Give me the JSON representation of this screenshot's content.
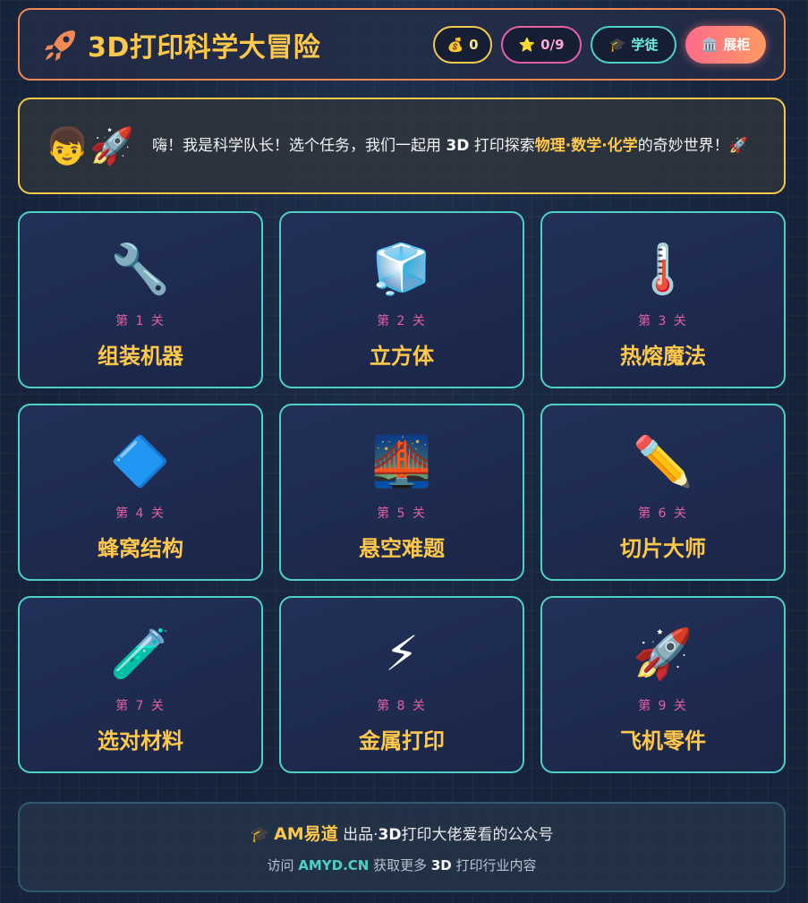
{
  "header": {
    "logo_icon": "rocket-icon",
    "title": "3D打印科学大冒险",
    "coins": {
      "icon": "💰",
      "value": "0"
    },
    "stars": {
      "icon": "⭐",
      "value": "0/9"
    },
    "rank": {
      "icon": "🎓",
      "label": "学徒"
    },
    "cabinet": {
      "icon": "🏛️",
      "label": "展柜"
    }
  },
  "banner": {
    "avatar": "👦",
    "rocket": "🚀",
    "msg_prefix": "嗨！我是科学队长！选个任务，我们一起用 ",
    "msg_3d": "3D",
    "msg_middle": " 打印探索",
    "msg_subjects": "物理·数学·化学",
    "msg_suffix": "的奇妙世界！🚀"
  },
  "levels": [
    {
      "icon": "🔧",
      "stage": "第 1 关",
      "name": "组装机器"
    },
    {
      "icon": "🧊",
      "stage": "第 2 关",
      "name": "立方体"
    },
    {
      "icon": "🌡️",
      "stage": "第 3 关",
      "name": "热熔魔法"
    },
    {
      "icon": "🔷",
      "stage": "第 4 关",
      "name": "蜂窝结构"
    },
    {
      "icon": "🌉",
      "stage": "第 5 关",
      "name": "悬空难题"
    },
    {
      "icon": "✏️",
      "stage": "第 6 关",
      "name": "切片大师"
    },
    {
      "icon": "🧪",
      "stage": "第 7 关",
      "name": "选对材料"
    },
    {
      "icon": "⚡",
      "stage": "第 8 关",
      "name": "金属打印"
    },
    {
      "icon": "🚀",
      "stage": "第 9 关",
      "name": "飞机零件"
    }
  ],
  "footer": {
    "cap_icon": "🎓",
    "brand": "AM易道",
    "line1_middle": " 出品·",
    "line1_3d": "3D",
    "line1_suffix": "打印大佬爱看的公众号",
    "line2_prefix": "访问 ",
    "site": "AMYD.CN",
    "line2_middle": " 获取更多 ",
    "line2_3d": "3D",
    "line2_suffix": " 打印行业内容"
  }
}
